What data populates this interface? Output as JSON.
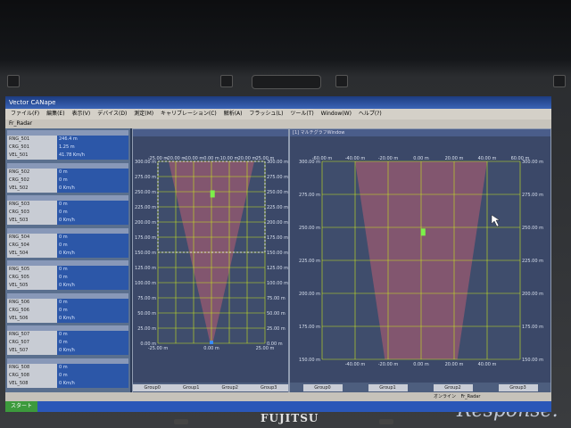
{
  "window": {
    "title": "Vector CANape"
  },
  "menu": [
    "ファイル(F)",
    "編集(E)",
    "表示(V)",
    "デバイス(D)",
    "測定(M)",
    "キャリブレーション(C)",
    "解析(A)",
    "フラッシュ(L)",
    "ツール(T)",
    "Window(W)",
    "ヘルプ(?)"
  ],
  "toolbar": {
    "label": "Fr_Radar"
  },
  "trace": [
    {
      "rows": [
        {
          "label": "RNG_501",
          "value": "246.4 m"
        },
        {
          "label": "CRG_501",
          "value": "1.25 m"
        },
        {
          "label": "VEL_501",
          "value": "41.78 Km/h"
        }
      ]
    },
    {
      "rows": [
        {
          "label": "RNG_502",
          "value": "0 m"
        },
        {
          "label": "CRG_502",
          "value": "0 m"
        },
        {
          "label": "VEL_502",
          "value": "0 Km/h"
        }
      ]
    },
    {
      "rows": [
        {
          "label": "RNG_503",
          "value": "0 m"
        },
        {
          "label": "CRG_503",
          "value": "0 m"
        },
        {
          "label": "VEL_503",
          "value": "0 Km/h"
        }
      ]
    },
    {
      "rows": [
        {
          "label": "RNG_504",
          "value": "0 m"
        },
        {
          "label": "CRG_504",
          "value": "0 m"
        },
        {
          "label": "VEL_504",
          "value": "0 Km/h"
        }
      ]
    },
    {
      "rows": [
        {
          "label": "RNG_505",
          "value": "0 m"
        },
        {
          "label": "CRG_505",
          "value": "0 m"
        },
        {
          "label": "VEL_505",
          "value": "0 Km/h"
        }
      ]
    },
    {
      "rows": [
        {
          "label": "RNG_506",
          "value": "0 m"
        },
        {
          "label": "CRG_506",
          "value": "0 m"
        },
        {
          "label": "VEL_506",
          "value": "0 Km/h"
        }
      ]
    },
    {
      "rows": [
        {
          "label": "RNG_507",
          "value": "0 m"
        },
        {
          "label": "CRG_507",
          "value": "0 m"
        },
        {
          "label": "VEL_507",
          "value": "0 Km/h"
        }
      ]
    },
    {
      "rows": [
        {
          "label": "RNG_508",
          "value": "0 m"
        },
        {
          "label": "CRG_508",
          "value": "0 m"
        },
        {
          "label": "VEL_508",
          "value": "0 Km/h"
        }
      ]
    }
  ],
  "left_plot": {
    "x_ticks": [
      "-25.00 m",
      "-20.00 m",
      "-10.00 m",
      "0.00 m",
      "10.00 m",
      "20.00 m",
      "25.00 m"
    ],
    "y_ticks": [
      "300.00 m",
      "275.00 m",
      "250.00 m",
      "225.00 m",
      "200.00 m",
      "175.00 m",
      "150.00 m",
      "125.00 m",
      "100.00 m",
      "75.00 m",
      "50.00 m",
      "25.00 m",
      "0.00 m"
    ],
    "y_ticks_right": [
      "300.00 m",
      "275.00 m",
      "250.00 m",
      "225.00 m",
      "200.00 m",
      "175.00 m",
      "150.00 m",
      "125.00 m",
      "100.00 m",
      "75.00 m",
      "50.00 m",
      "25.00 m",
      "0.00 m"
    ],
    "bottom_ticks": [
      "-25.00 m",
      "0.00 m",
      "25.00 m"
    ],
    "target": {
      "x_m": 0.5,
      "range_m": 246.4
    }
  },
  "right_plot": {
    "header": "[1] マルチグラフWindow",
    "x_ticks": [
      "-60.00 m",
      "-40.00 m",
      "-20.00 m",
      "0.00 m",
      "20.00 m",
      "40.00 m",
      "60.00 m"
    ],
    "y_ticks": [
      "300.00 m",
      "275.00 m",
      "250.00 m",
      "225.00 m",
      "200.00 m",
      "175.00 m",
      "150.00 m"
    ],
    "y_ticks_right": [
      "300.00 m",
      "275.00 m",
      "250.00 m",
      "225.00 m",
      "200.00 m",
      "175.00 m",
      "150.00 m"
    ],
    "bottom_ticks": [
      "-40.00 m",
      "-20.00 m",
      "0.00 m",
      "20.00 m",
      "40.00 m"
    ],
    "target": {
      "x_m": 1.25,
      "range_m": 246.4
    }
  },
  "groups": [
    "Group0",
    "Group1",
    "Group2",
    "Group3"
  ],
  "status": {
    "left": "オンライン",
    "right": "Fr_Radar"
  },
  "taskbar": {
    "start": "スタート"
  },
  "bezel": {
    "brand": "FUJITSU",
    "watermark": "Response."
  },
  "colors": {
    "grid": "#c8e61e",
    "fov": "#a05a70",
    "target": "#7cf04a"
  }
}
